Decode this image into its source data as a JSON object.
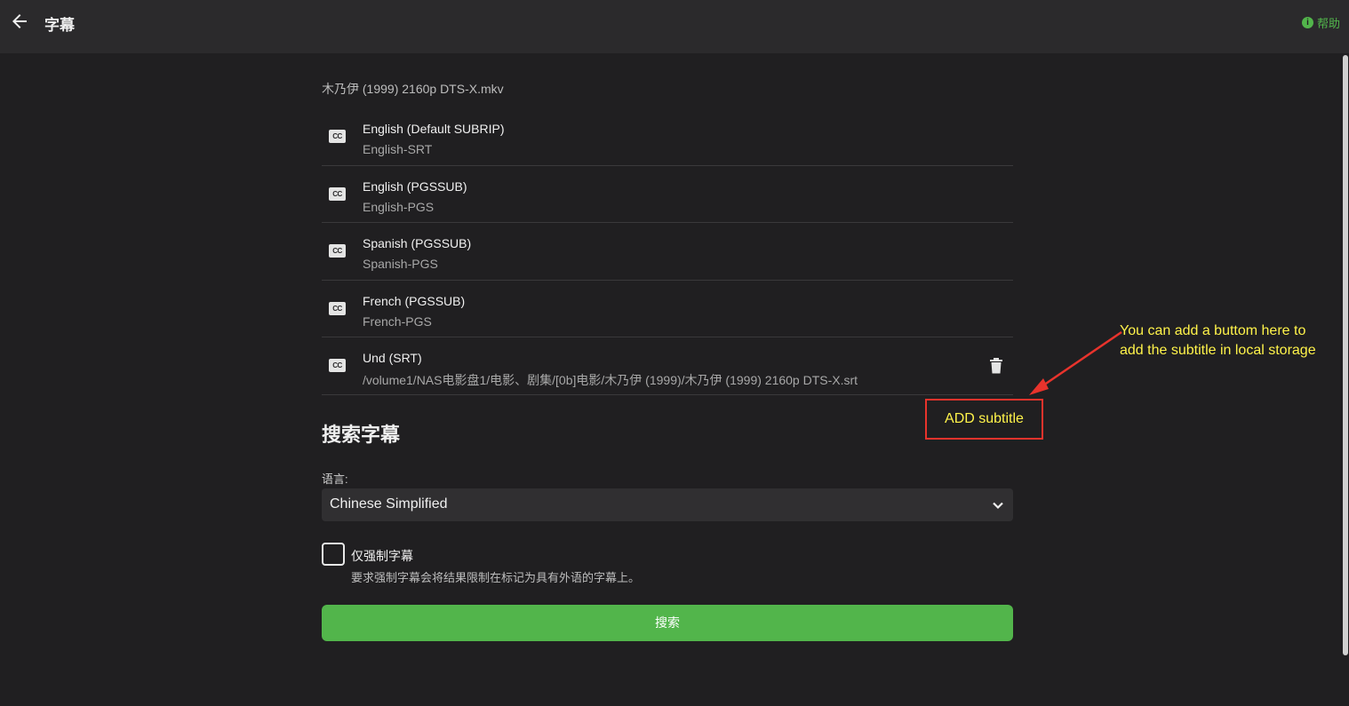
{
  "header": {
    "title": "字幕",
    "help_label": "帮助",
    "help_icon": "i"
  },
  "media": {
    "filename": "木乃伊 (1999) 2160p DTS-X.mkv"
  },
  "tracks": [
    {
      "title": "English (Default SUBRIP)",
      "subtitle": "English-SRT"
    },
    {
      "title": "English (PGSSUB)",
      "subtitle": "English-PGS"
    },
    {
      "title": "Spanish (PGSSUB)",
      "subtitle": "Spanish-PGS"
    },
    {
      "title": "French (PGSSUB)",
      "subtitle": "French-PGS"
    },
    {
      "title": "Und (SRT)",
      "subtitle": "/volume1/NAS电影盘1/电影、剧集/[0b]电影/木乃伊 (1999)/木乃伊 (1999) 2160p DTS-X.srt"
    }
  ],
  "cc_icon_text": "CC",
  "search": {
    "section_title": "搜索字幕",
    "language_label": "语言:",
    "language_value": "Chinese Simplified",
    "forced_only_label": "仅强制字幕",
    "forced_only_desc": "要求强制字幕会将结果限制在标记为具有外语的字幕上。",
    "search_button": "搜索"
  },
  "annotation": {
    "box_text": "ADD subtitle",
    "note_line1": "You can add a buttom here to",
    "note_line2": "add the subtitle in local storage"
  },
  "colors": {
    "accent": "#52b54b",
    "annotation_text": "#fff34a",
    "annotation_border": "#e8332c"
  }
}
